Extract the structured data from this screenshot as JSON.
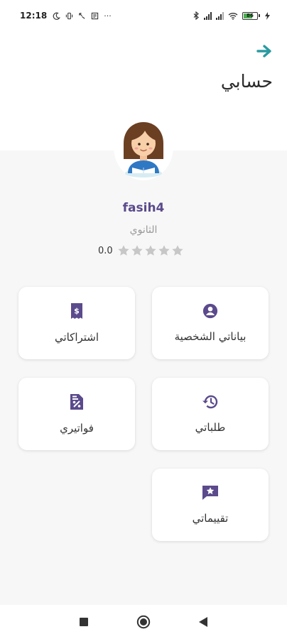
{
  "status_bar": {
    "time": "12:18",
    "battery_level": "86",
    "notification_icons": [
      "moon-icon",
      "vibrate-icon",
      "call-forward-icon",
      "news-icon",
      "more-dots-icon"
    ],
    "dots": "···"
  },
  "header": {
    "title": "حسابي",
    "back_icon": "arrow-right-icon"
  },
  "profile": {
    "username": "fasih4",
    "grade": "الثانوي",
    "rating": "0.0",
    "stars_filled": 0,
    "stars_total": 5
  },
  "menu": {
    "profile_data": {
      "label": "بياناتي الشخصية",
      "icon": "account-circle-icon"
    },
    "subscriptions": {
      "label": "اشتراكاتي",
      "icon": "receipt-dollar-icon"
    },
    "orders": {
      "label": "طلباتي",
      "icon": "history-icon"
    },
    "invoices": {
      "label": "فواتيري",
      "icon": "invoice-percent-icon"
    },
    "reviews": {
      "label": "تقييماتي",
      "icon": "star-comment-icon"
    }
  },
  "colors": {
    "accent": "#5b4a8c",
    "back_arrow": "#2a9aa0",
    "star_empty": "#c7c7c7",
    "background": "#f7f7f7"
  }
}
